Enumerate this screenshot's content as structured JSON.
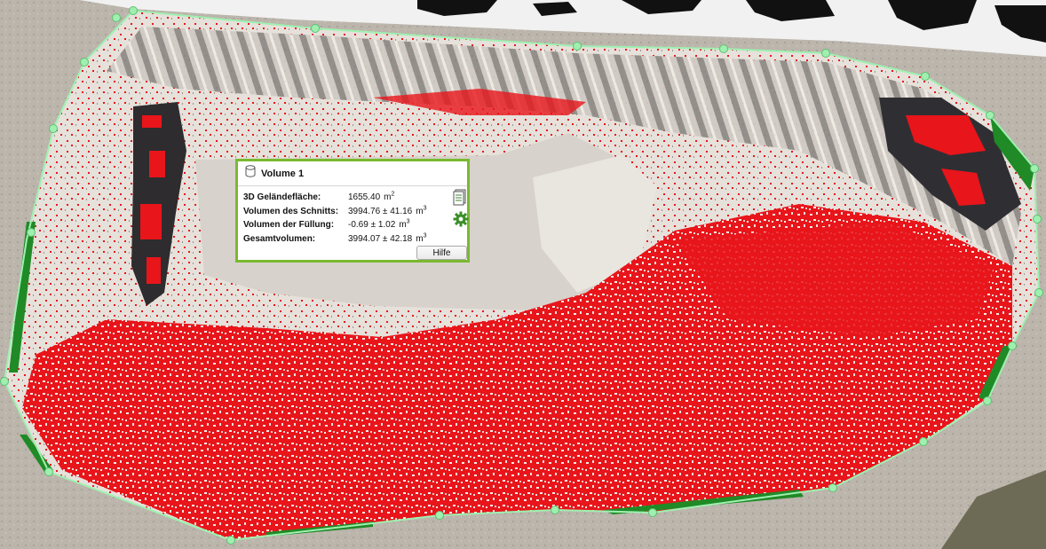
{
  "panel": {
    "title": "Volume 1",
    "icon": "cylinder-icon",
    "rows": [
      {
        "label": "3D Geländefläche:",
        "value": "1655.40",
        "unit": "m",
        "exp": "2"
      },
      {
        "label": "Volumen des Schnitts:",
        "value": "3994.76  ± 41.16",
        "unit": "m",
        "exp": "3"
      },
      {
        "label": "Volumen der Füllung:",
        "value": "-0.69  ± 1.02",
        "unit": "m",
        "exp": "3"
      },
      {
        "label": "Gesamtvolumen:",
        "value": "3994.07  ± 42.18",
        "unit": "m",
        "exp": "3"
      }
    ],
    "help_label": "Hilfe",
    "side_icons": [
      "report-document-icon",
      "settings-gear-icon"
    ]
  },
  "colors": {
    "boundary": "#9ff0b0",
    "panel_border": "#7ab92f",
    "cut_volume": "#e8151b",
    "fill_volume": "#1f8a26"
  }
}
